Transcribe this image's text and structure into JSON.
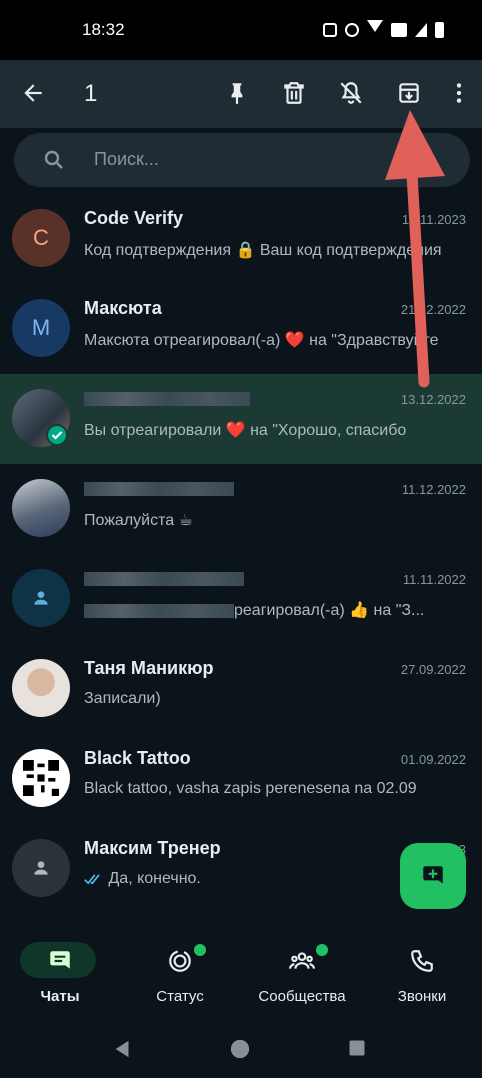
{
  "status_bar": {
    "time": "18:32"
  },
  "top_bar": {
    "selected_count": "1",
    "icons": [
      "back-arrow-icon",
      "pin-icon",
      "delete-icon",
      "mute-icon",
      "archive-icon",
      "more-vert-icon"
    ]
  },
  "search": {
    "placeholder": "Поиск..."
  },
  "chats": [
    {
      "name": "Code Verify",
      "date": "12.11.2023",
      "message": "Код подтверждения 🔒 Ваш код подтверждения",
      "avatar_letter": "C"
    },
    {
      "name": "Максюта",
      "date": "21.12.2022",
      "message": "Максюта отреагировал(-а) ❤️ на \"Здравствуйте",
      "avatar_letter": "M"
    },
    {
      "name": "",
      "date": "13.12.2022",
      "message": "Вы отреагировали ❤️ на \"Хорошо, спасибо",
      "selected": true
    },
    {
      "name": "",
      "date": "11.12.2022",
      "message": "Пожалуйста ☕"
    },
    {
      "name": "",
      "date": "11.11.2022",
      "message": "реагировал(-а) 👍 на \"З..."
    },
    {
      "name": "Таня Маникюр",
      "date": "27.09.2022",
      "message": "Записали)"
    },
    {
      "name": "Black Tattoo",
      "date": "01.09.2022",
      "message": "Black tattoo, vasha zapis perenesena na 02.09"
    },
    {
      "name": "Максим Тренер",
      "date": "3",
      "message": "Да, конечно."
    }
  ],
  "bottom_nav": {
    "chats": "Чаты",
    "status": "Статус",
    "communities": "Сообщества",
    "calls": "Звонки"
  },
  "colors": {
    "accent": "#21c063",
    "selected_row": "#1a3a33",
    "background": "#0b141a",
    "annotation_arrow": "#e0605a"
  }
}
